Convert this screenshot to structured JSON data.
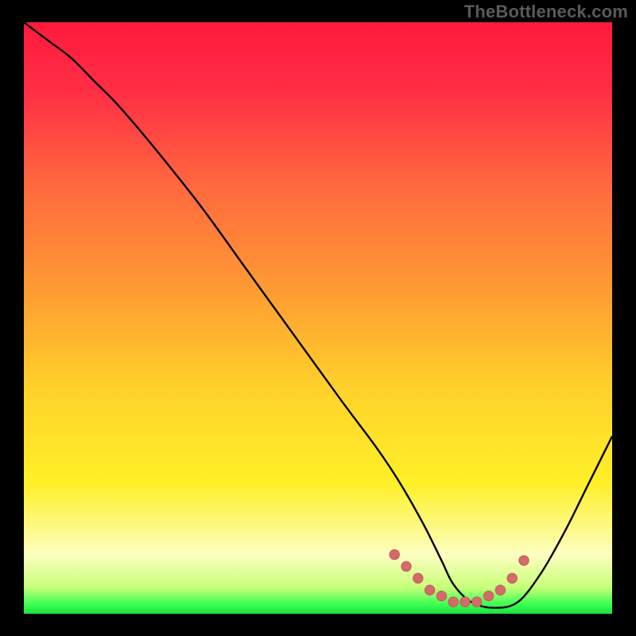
{
  "watermark": "TheBottleneck.com",
  "colors": {
    "background": "#000000",
    "gradient_stops": [
      {
        "offset": 0.0,
        "color": "#ff1a3c"
      },
      {
        "offset": 0.12,
        "color": "#ff2f45"
      },
      {
        "offset": 0.28,
        "color": "#ff6a3e"
      },
      {
        "offset": 0.45,
        "color": "#ff9a33"
      },
      {
        "offset": 0.62,
        "color": "#ffd22a"
      },
      {
        "offset": 0.78,
        "color": "#fff028"
      },
      {
        "offset": 0.9,
        "color": "#fdfec0"
      },
      {
        "offset": 0.955,
        "color": "#c8ff7a"
      },
      {
        "offset": 0.985,
        "color": "#3aff52"
      },
      {
        "offset": 1.0,
        "color": "#18e03e"
      }
    ],
    "curve": "#000000",
    "marker_fill": "#d46a6a",
    "marker_stroke": "#c65a5a"
  },
  "chart_data": {
    "type": "line",
    "title": "",
    "xlabel": "",
    "ylabel": "",
    "xlim": [
      0,
      100
    ],
    "ylim": [
      0,
      100
    ],
    "grid": false,
    "series": [
      {
        "name": "bottleneck-curve",
        "x": [
          0,
          4,
          8,
          12,
          16,
          22,
          30,
          38,
          46,
          54,
          60,
          64,
          68,
          71,
          73,
          76,
          80,
          84,
          88,
          92,
          96,
          100
        ],
        "y": [
          100,
          97,
          94,
          90,
          86,
          79,
          69,
          58,
          47,
          36,
          28,
          22,
          15,
          9,
          5,
          2,
          1,
          2,
          7,
          14,
          22,
          30
        ]
      }
    ],
    "markers": {
      "name": "highlighted-minimum-band",
      "x": [
        63,
        65,
        67,
        69,
        71,
        73,
        75,
        77,
        79,
        81,
        83,
        85
      ],
      "y": [
        10,
        8,
        6,
        4,
        3,
        2,
        2,
        2,
        3,
        4,
        6,
        9
      ]
    }
  }
}
